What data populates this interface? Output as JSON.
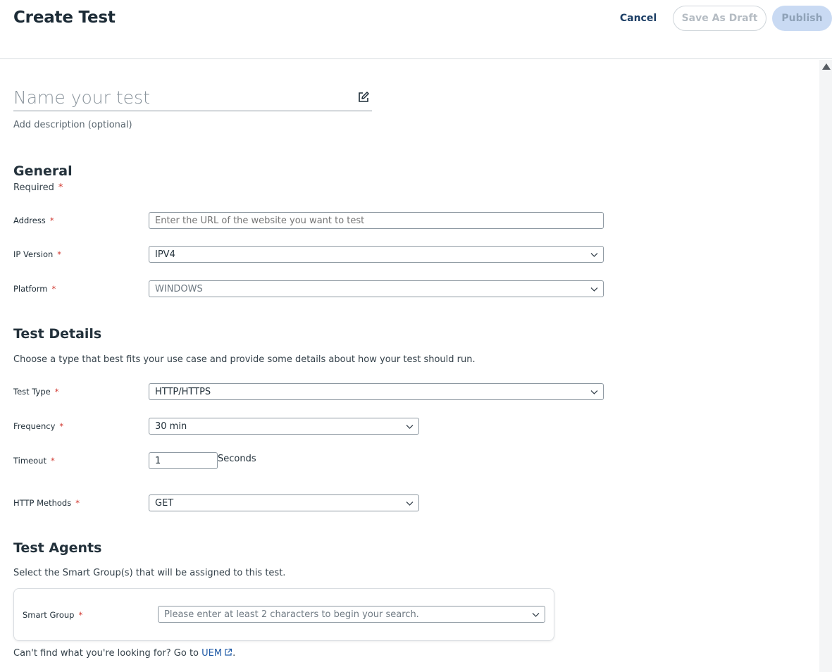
{
  "header": {
    "title": "Create Test",
    "cancel_label": "Cancel",
    "save_draft_label": "Save As Draft",
    "publish_label": "Publish"
  },
  "test_name": {
    "placeholder": "Name your test",
    "value": "",
    "add_description": "Add description (optional)"
  },
  "general": {
    "title": "General",
    "required_label": "Required",
    "address": {
      "label": "Address",
      "placeholder": "Enter the URL of the website you want to test"
    },
    "ip_version": {
      "label": "IP Version",
      "value": "IPV4"
    },
    "platform": {
      "label": "Platform",
      "value": "WINDOWS"
    }
  },
  "test_details": {
    "title": "Test Details",
    "description": "Choose a type that best fits your use case and provide some details about how your test should run.",
    "test_type": {
      "label": "Test Type",
      "value": "HTTP/HTTPS"
    },
    "frequency": {
      "label": "Frequency",
      "value": "30 min"
    },
    "timeout": {
      "label": "Timeout",
      "value": "1",
      "unit": "Seconds"
    },
    "http_methods": {
      "label": "HTTP Methods",
      "value": "GET"
    }
  },
  "test_agents": {
    "title": "Test Agents",
    "description": "Select the Smart Group(s) that will be assigned to this test.",
    "smart_group": {
      "label": "Smart Group",
      "placeholder": "Please enter at least 2 characters to begin your search."
    },
    "footer_prefix": "Can't find what you're looking for? Go to ",
    "footer_link": "UEM",
    "footer_suffix": "."
  },
  "required_marker": "*",
  "colors": {
    "primary_text": "#1c2b36",
    "link": "#1f5aa6",
    "required": "#d0342c",
    "publish_bg": "#c9daf3"
  }
}
